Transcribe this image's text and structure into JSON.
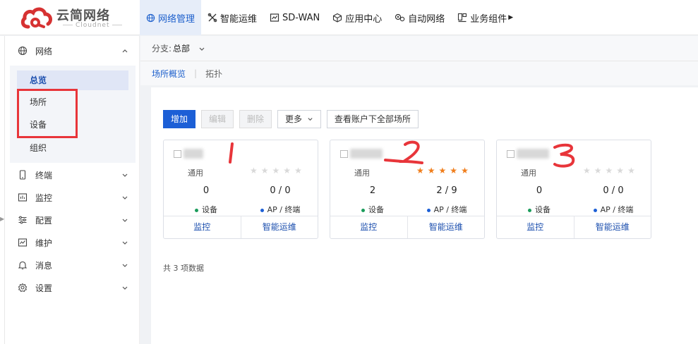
{
  "logo": {
    "cn": "云简网络",
    "en": "Cloudnet"
  },
  "topnav": {
    "items": [
      {
        "label": "网络管理",
        "icon": "globe-icon",
        "active": true
      },
      {
        "label": "智能运维",
        "icon": "tools-icon"
      },
      {
        "label": "SD-WAN",
        "icon": "sdwan-icon"
      },
      {
        "label": "应用中心",
        "icon": "cube-icon"
      },
      {
        "label": "自动网络",
        "icon": "gears-icon"
      },
      {
        "label": "业务组件",
        "icon": "grid-icon"
      }
    ]
  },
  "sidebar": {
    "groups": [
      {
        "label": "网络",
        "icon": "globe-icon",
        "expanded": true
      },
      {
        "label": "终端",
        "icon": "phone-icon"
      },
      {
        "label": "监控",
        "icon": "chart-icon"
      },
      {
        "label": "配置",
        "icon": "sliders-icon"
      },
      {
        "label": "维护",
        "icon": "wrench-icon"
      },
      {
        "label": "消息",
        "icon": "bell-icon"
      },
      {
        "label": "设置",
        "icon": "settings-icon"
      }
    ],
    "subitems": [
      {
        "label": "总览",
        "active": true
      },
      {
        "label": "场所"
      },
      {
        "label": "设备"
      },
      {
        "label": "组织"
      }
    ]
  },
  "branch": {
    "key": "分支:",
    "value": "总部"
  },
  "tabs": [
    {
      "label": "场所概览",
      "active": true
    },
    {
      "label": "拓扑"
    }
  ],
  "toolbar": {
    "add": "增加",
    "edit": "编辑",
    "delete": "删除",
    "more": "更多",
    "view_all": "查看账户下全部场所"
  },
  "cards": [
    {
      "type": "通用",
      "rating": 0,
      "devices": "0",
      "aps": "0 / 0",
      "device_label": "设备",
      "ap_label": "AP / 终端",
      "monitor": "监控",
      "ops": "智能运维",
      "annotation": "1"
    },
    {
      "type": "通用",
      "rating": 5,
      "devices": "2",
      "aps": "2 / 9",
      "device_label": "设备",
      "ap_label": "AP / 终端",
      "monitor": "监控",
      "ops": "智能运维",
      "annotation": "2"
    },
    {
      "type": "通用",
      "rating": 0,
      "devices": "0",
      "aps": "0 / 0",
      "device_label": "设备",
      "ap_label": "AP / 终端",
      "monitor": "监控",
      "ops": "智能运维",
      "annotation": "3"
    }
  ],
  "total_text": "共 3 项数据",
  "colors": {
    "accent": "#1c5fd6",
    "star_on": "#f07e1c",
    "annotation_red": "#e8353a",
    "logo_red": "#d63232"
  }
}
